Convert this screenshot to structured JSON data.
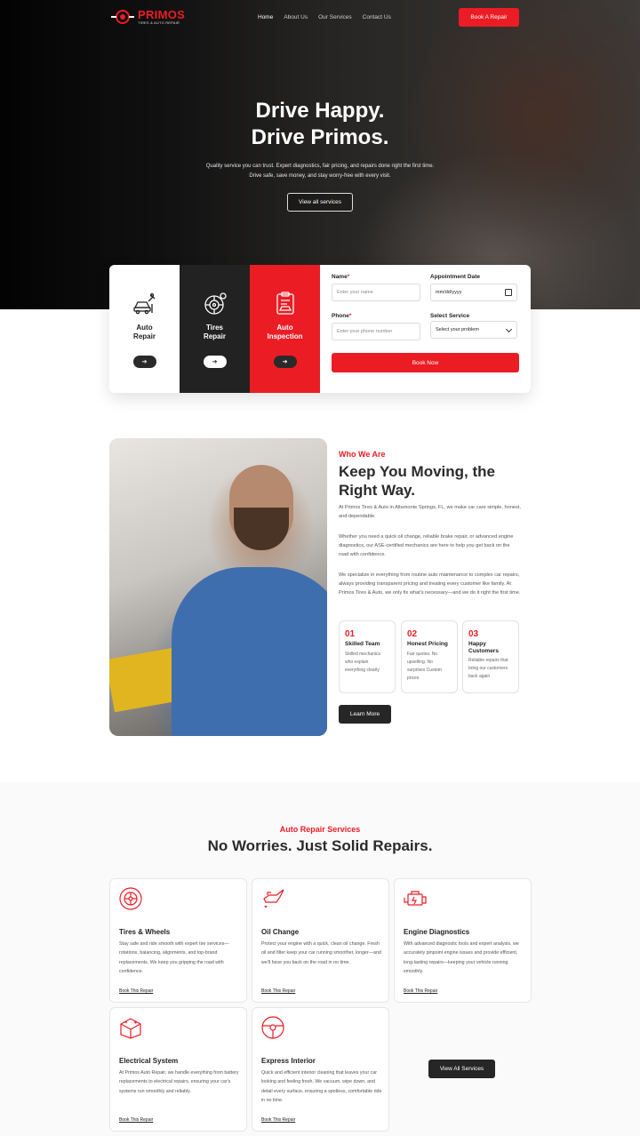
{
  "colors": {
    "accent": "#ec1c24",
    "dark": "#1f1f1f"
  },
  "header": {
    "brand": "PRIMOS",
    "brand_tagline": "TIRES & AUTO REPAIR",
    "nav": [
      {
        "label": "Home",
        "active": true
      },
      {
        "label": "About Us"
      },
      {
        "label": "Our Services"
      },
      {
        "label": "Contact Us"
      }
    ],
    "cta": "Book A Repair"
  },
  "hero": {
    "title_line1": "Drive Happy.",
    "title_line2": "Drive Primos.",
    "subtitle": "Quality service you can trust. Expert diagnostics, fair pricing, and repairs done right the first time. Drive safe, save money, and stay worry-free with every visit.",
    "button": "View all services"
  },
  "booking": {
    "services": [
      {
        "label": "Auto Repair",
        "icon": "car-repair-icon"
      },
      {
        "label": "Tires Repair",
        "icon": "tire-icon"
      },
      {
        "label": "Auto Inspection",
        "icon": "clipboard-car-icon"
      }
    ],
    "form": {
      "name_label": "Name",
      "name_placeholder": "Enter your name",
      "date_label": "Appointment Date",
      "date_value": "mm/dd/yyyy",
      "phone_label": "Phone",
      "phone_placeholder": "Enter your phone number",
      "service_label": "Select Service",
      "service_value": "Select your problem",
      "required_mark": "*",
      "submit": "Book Now"
    }
  },
  "about": {
    "eyebrow": "Who We Are",
    "title": "Keep You Moving, the Right Way.",
    "paragraphs": [
      "At Primos Tires & Auto in Altamonte Springs, FL, we make car care simple, honest, and dependable.",
      "Whether you need a quick oil change, reliable brake repair, or advanced engine diagnostics, our ASE-certified mechanics are here to help you get back on the road with confidence.",
      "We specialize in everything from routine auto maintenance to complex car repairs, always providing transparent pricing and treating every customer like family. At Primos Tires & Auto, we only fix what's necessary—and we do it right the first time."
    ],
    "stats": [
      {
        "num": "01",
        "title": "Skilled Team",
        "desc": "Skilled mechanics who explain everything clearly"
      },
      {
        "num": "02",
        "title": "Honest Pricing",
        "desc": "Fair quotes. No upselling. No surprises Custom prices"
      },
      {
        "num": "03",
        "title": "Happy Customers",
        "desc": "Reliable repairs that bring our customers back again"
      }
    ],
    "button": "Learn More"
  },
  "services": {
    "eyebrow": "Auto Repair Services",
    "title": "No Worries. Just Solid Repairs.",
    "cards": [
      {
        "title": "Tires & Wheels",
        "icon": "wheel-icon",
        "desc": "Stay safe and ride smooth with expert tire services—rotations, balancing, alignments, and top-brand replacements. We keep you gripping the road with confidence.",
        "link": "Book This Repair"
      },
      {
        "title": "Oil Change",
        "icon": "oil-can-icon",
        "desc": "Protect your engine with a quick, clean oil change. Fresh oil and filter keep your car running smoother, longer—and we'll have you back on the road in no time.",
        "link": "Book This Repair"
      },
      {
        "title": "Engine Diagnostics",
        "icon": "engine-icon",
        "desc": "With advanced diagnostic tools and expert analysis, we accurately pinpoint engine issues and provide efficient, long-lasting repairs—keeping your vehicle running smoothly.",
        "link": "Book This Repair"
      },
      {
        "title": "Electrical System",
        "icon": "battery-icon",
        "desc": "At Primos Auto Repair, we handle everything from battery replacements to electrical repairs, ensuring your car's systems run smoothly and reliably.",
        "link": "Book This Repair"
      },
      {
        "title": "Express Interior",
        "icon": "steering-wheel-icon",
        "desc": "Quick and efficient interior cleaning that leaves your car looking and feeling fresh. We vacuum, wipe down, and detail every surface, ensuring a spotless, comfortable ride in no time.",
        "link": "Book This Repair"
      }
    ],
    "view_all": "View All Services"
  }
}
